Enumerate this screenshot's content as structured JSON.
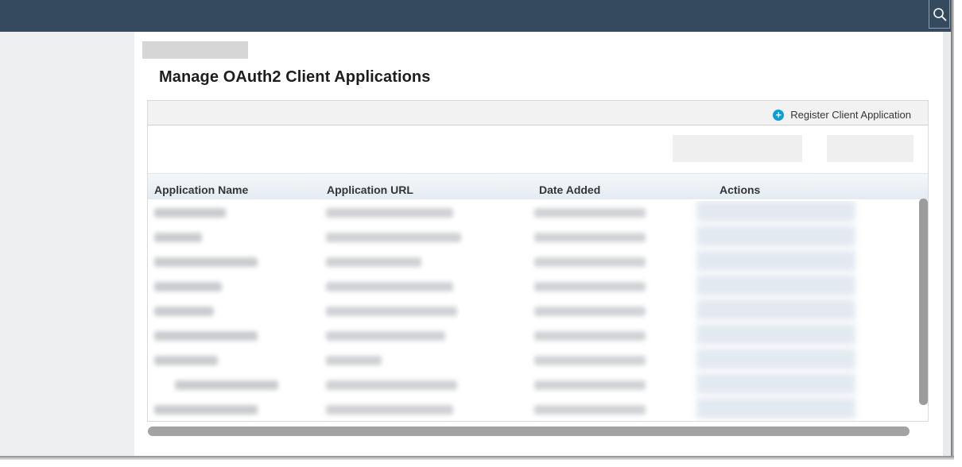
{
  "header": {
    "search_icon": "search-icon"
  },
  "page": {
    "title": "Manage OAuth2 Client Applications"
  },
  "toolbar": {
    "register_label": "Register Client Application",
    "register_icon": "plus-circle-icon",
    "accent_color": "#0a9ed9"
  },
  "table": {
    "columns": [
      {
        "label": "Application Name"
      },
      {
        "label": "Application URL"
      },
      {
        "label": "Date Added"
      },
      {
        "label": "Actions"
      }
    ],
    "rows_blurred": true
  },
  "colors": {
    "header_bg": "#354a5f",
    "sidebar_bg": "#eeeff1"
  }
}
